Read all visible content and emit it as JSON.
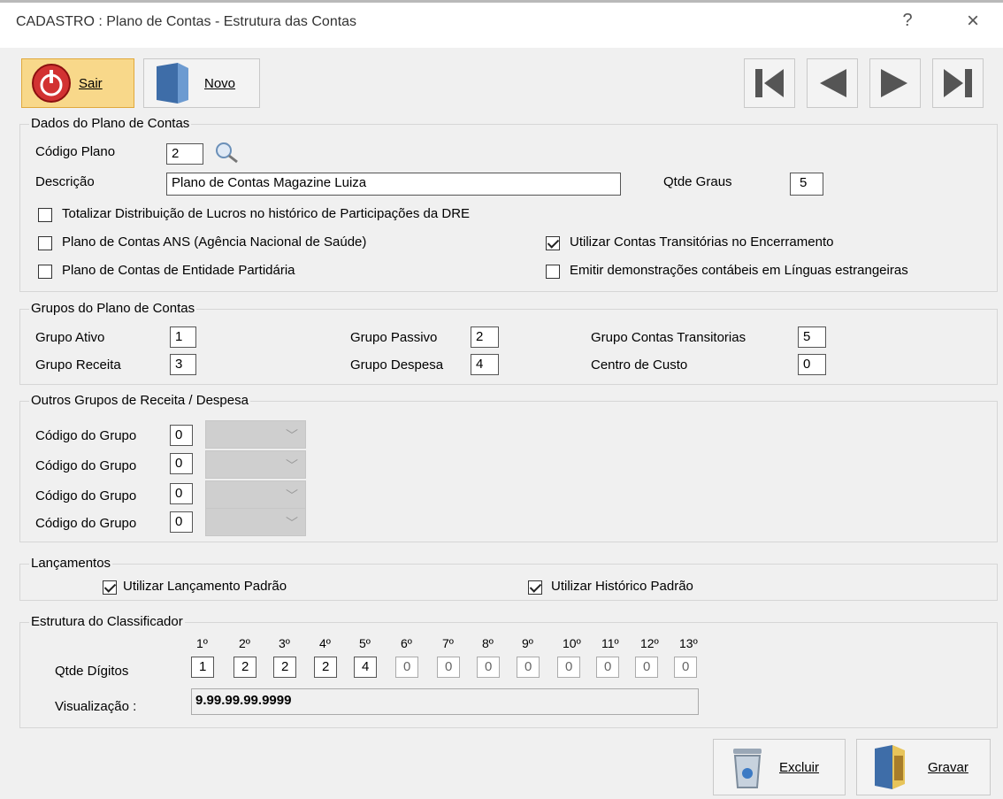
{
  "window": {
    "title": "CADASTRO : Plano de Contas - Estrutura das Contas",
    "help": "?",
    "close": "×"
  },
  "toolbar": {
    "sair": "Sair",
    "novo": "Novo"
  },
  "dados": {
    "legend": "Dados do Plano de Contas",
    "codigo_label": "Código Plano",
    "codigo_value": "2",
    "descricao_label": "Descrição",
    "descricao_value": "Plano de Contas Magazine Luiza",
    "graus_label": "Qtde Graus",
    "graus_value": "5",
    "chk_totalizar": "Totalizar Distribuição de Lucros no histórico de Participações da DRE",
    "chk_ans": "Plano de Contas ANS (Agência Nacional de Saúde)",
    "chk_transit": "Utilizar Contas Transitórias no Encerramento",
    "chk_partidaria": "Plano de Contas de Entidade Partidária",
    "chk_linguas": "Emitir demonstrações contábeis em Línguas estrangeiras"
  },
  "grupos": {
    "legend": "Grupos do Plano de Contas",
    "ativo_label": "Grupo Ativo",
    "ativo_value": "1",
    "passivo_label": "Grupo Passivo",
    "passivo_value": "2",
    "transit_label": "Grupo Contas Transitorias",
    "transit_value": "5",
    "receita_label": "Grupo Receita",
    "receita_value": "3",
    "despesa_label": "Grupo Despesa",
    "despesa_value": "4",
    "custo_label": "Centro de Custo",
    "custo_value": "0"
  },
  "outros": {
    "legend": "Outros Grupos de Receita / Despesa",
    "rows": [
      {
        "label": "Código do Grupo",
        "value": "0"
      },
      {
        "label": "Código do Grupo",
        "value": "0"
      },
      {
        "label": "Código do Grupo",
        "value": "0"
      },
      {
        "label": "Código do Grupo",
        "value": "0"
      }
    ]
  },
  "lancamentos": {
    "legend": "Lançamentos",
    "chk_padrao": "Utilizar Lançamento Padrão",
    "chk_historico": "Utilizar Histórico Padrão"
  },
  "estrutura": {
    "legend": "Estrutura do Classificador",
    "headers": [
      "1º",
      "2º",
      "3º",
      "4º",
      "5º",
      "6º",
      "7º",
      "8º",
      "9º",
      "10º",
      "11º",
      "12º",
      "13º"
    ],
    "digitos_label": "Qtde Dígitos",
    "digitos": [
      "1",
      "2",
      "2",
      "2",
      "4",
      "0",
      "0",
      "0",
      "0",
      "0",
      "0",
      "0",
      "0"
    ],
    "visual_label": "Visualização :",
    "visual_value": "9.99.99.99.9999"
  },
  "bottom": {
    "excluir": "Excluir",
    "gravar": "Gravar"
  },
  "colors": {
    "accent_active": "#f8d88a",
    "frame": "#d6d6d6"
  }
}
